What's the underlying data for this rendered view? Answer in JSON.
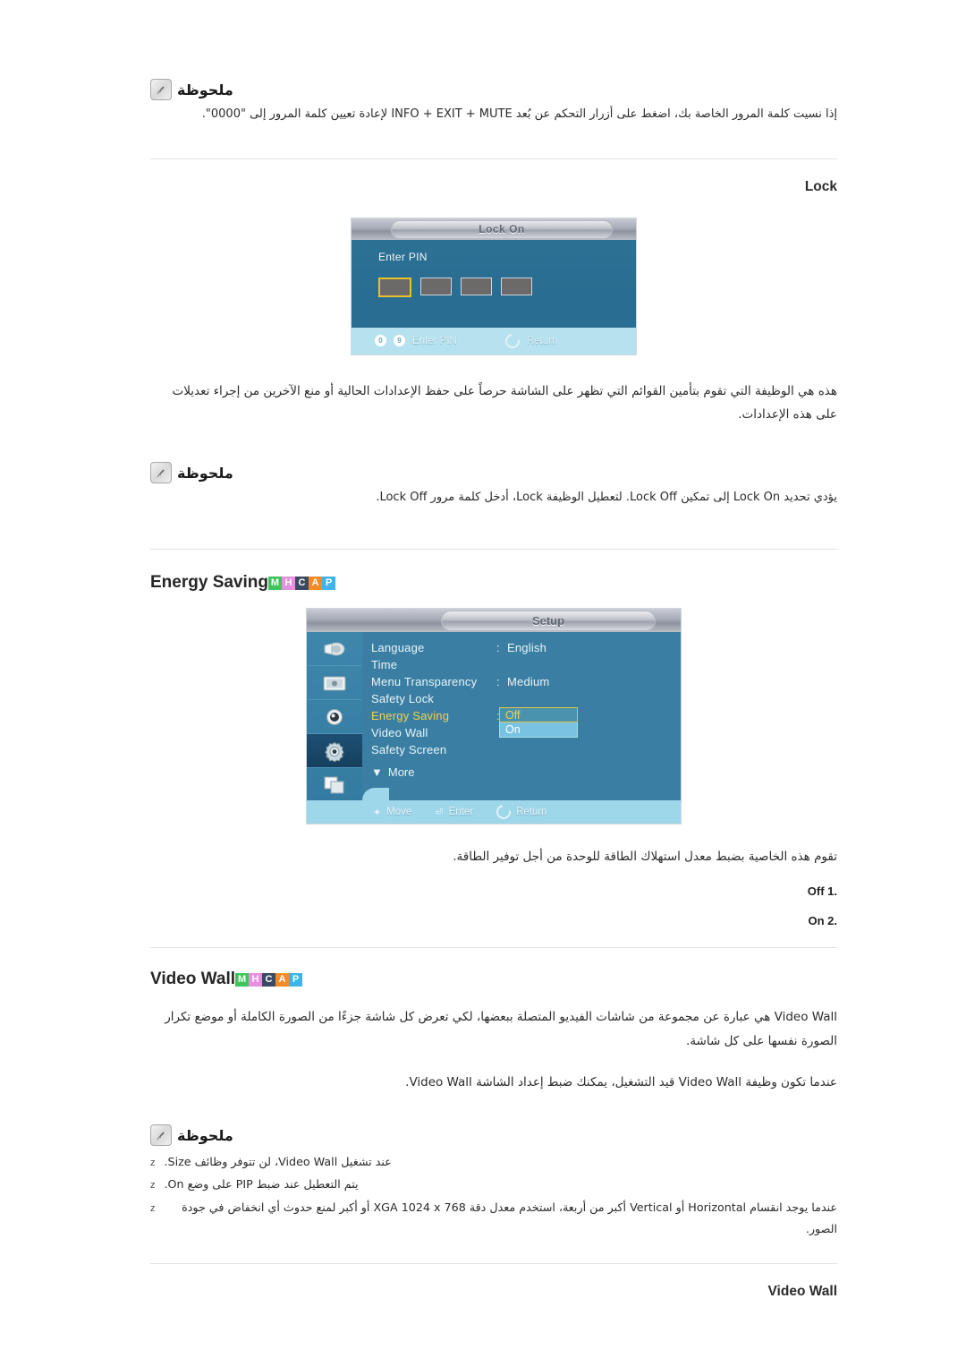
{
  "notes": {
    "title": "ملحوظة",
    "icon": "note-pencil-icon",
    "note1_text": "إذا نسيت كلمة المرور الخاصة بك، اضغط على أزرار التحكم عن بُعد INFO + EXIT + MUTE لإعادة تعيين كلمة المرور إلى \"0000\".",
    "note2_text": "يؤدي تحديد Lock On إلى تمكين Lock Off. لتعطيل الوظيفة Lock، أدخل كلمة مرور Lock Off.",
    "note3_bullets": [
      {
        "marker": "z",
        "text": "عند تشغيل Video Wall، لن تتوفر وظائف Size."
      },
      {
        "marker": "z",
        "text": "يتم التعطيل عند ضبط PIP على وضع On."
      },
      {
        "marker": "z",
        "text": "عندما يوجد انقسام Horizontal أو Vertical أكبر من أربعة، استخدم معدل دقة XGA 1024 x 768 أو أكبر لمنع حدوث أي انخفاض في جودة الصور."
      }
    ]
  },
  "sections": {
    "lock": {
      "heading": "Lock",
      "description": "هذه هي الوظيفة التي تقوم بتأمين القوائم التي تظهر على الشاشة حرصاً على حفظ الإعدادات الحالية أو منع الآخرين من إجراء تعديلات على هذه الإعدادات."
    },
    "energy_saving": {
      "heading": "Energy Saving",
      "badges": [
        {
          "letter": "M",
          "color": "#3fc55c"
        },
        {
          "letter": "H",
          "color": "#e98fe0"
        },
        {
          "letter": "C",
          "color": "#3b4a63"
        },
        {
          "letter": "A",
          "color": "#f58a28"
        },
        {
          "letter": "P",
          "color": "#3fb4e8"
        }
      ],
      "description": "تقوم هذه الخاصية بضبط معدل استهلاك الطاقة للوحدة من أجل توفير الطاقة.",
      "options": [
        {
          "num": "1.",
          "value": "Off"
        },
        {
          "num": "2.",
          "value": "On"
        }
      ]
    },
    "video_wall": {
      "heading": "Video Wall",
      "badges": [
        {
          "letter": "M",
          "color": "#3fc55c"
        },
        {
          "letter": "H",
          "color": "#e98fe0"
        },
        {
          "letter": "C",
          "color": "#3b4a63"
        },
        {
          "letter": "A",
          "color": "#f58a28"
        },
        {
          "letter": "P",
          "color": "#3fb4e8"
        }
      ],
      "paragraph1": "Video Wall هي عبارة عن مجموعة من شاشات الفيديو المتصلة ببعضها، لكي تعرض كل شاشة جزءًا من الصورة الكاملة أو موضع تكرار الصورة نفسها على كل شاشة.",
      "paragraph2": "عندما تكون وظيفة Video Wall قيد التشغيل، يمكنك ضبط إعداد الشاشة Video Wall.",
      "subheading": "Video Wall"
    }
  },
  "osd_lock": {
    "title": "Lock On",
    "pin_label": "Enter PIN",
    "pin_boxes": [
      "",
      "",
      "",
      ""
    ],
    "selected_box_index": 0,
    "footer": {
      "btn1": "0",
      "btn2": "9",
      "btn_label": "Enter PIN",
      "return_label": "Return"
    }
  },
  "osd_setup": {
    "title": "Setup",
    "icons": [
      {
        "name": "picture-icon",
        "selected": false
      },
      {
        "name": "screen-icon",
        "selected": false
      },
      {
        "name": "sound-icon",
        "selected": false
      },
      {
        "name": "gear-setup-icon",
        "selected": true
      },
      {
        "name": "multi-display-icon",
        "selected": false
      }
    ],
    "rows": [
      {
        "label": "Language",
        "colon": ":",
        "value": "English",
        "highlighted": false
      },
      {
        "label": "Time",
        "colon": "",
        "value": "",
        "highlighted": false
      },
      {
        "label": "Menu Transparency",
        "colon": ":",
        "value": "Medium",
        "highlighted": false
      },
      {
        "label": "Safety Lock",
        "colon": "",
        "value": "",
        "highlighted": false
      },
      {
        "label": "Energy Saving",
        "colon": ":",
        "value": "",
        "highlighted": true
      },
      {
        "label": "Video Wall",
        "colon": "",
        "value": "",
        "highlighted": false
      },
      {
        "label": "Safety Screen",
        "colon": "",
        "value": "",
        "highlighted": false
      }
    ],
    "more_label": "More",
    "dropdown": {
      "option_off": "Off",
      "option_on": "On",
      "selected": "Off"
    },
    "footer": {
      "move": "Move",
      "enter": "Enter",
      "return": "Return"
    }
  }
}
